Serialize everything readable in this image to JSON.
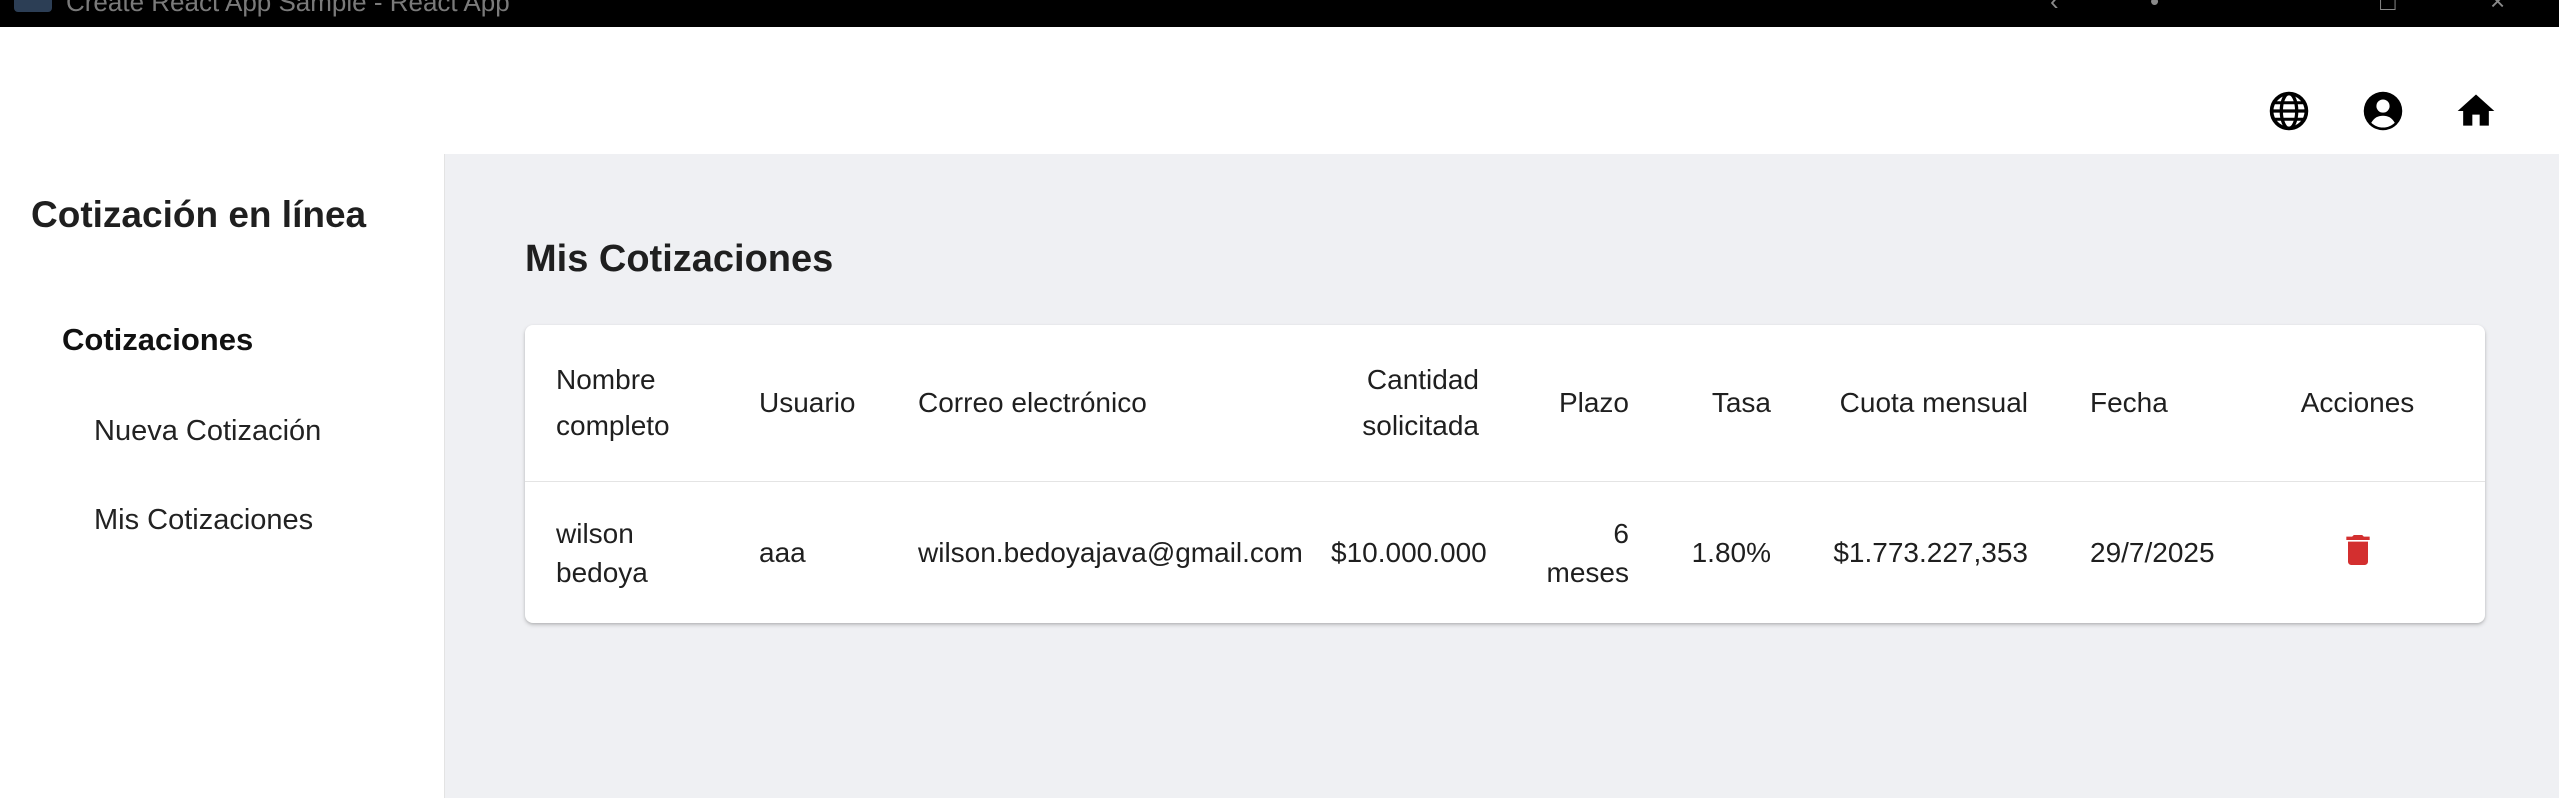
{
  "window": {
    "title": "Create React App Sample - React App"
  },
  "header": {
    "icons": [
      "globe-icon",
      "account-circle-icon",
      "home-icon"
    ]
  },
  "sidebar": {
    "app_title": "Cotización en línea",
    "section": "Cotizaciones",
    "items": [
      {
        "label": "Nueva Cotización"
      },
      {
        "label": "Mis Cotizaciones"
      }
    ]
  },
  "main": {
    "title": "Mis Cotizaciones",
    "table": {
      "headers": {
        "nombre": "Nombre completo",
        "usuario": "Usuario",
        "correo": "Correo electrónico",
        "cantidad": "Cantidad solicitada",
        "plazo": "Plazo",
        "tasa": "Tasa",
        "cuota": "Cuota mensual",
        "fecha": "Fecha",
        "acciones": "Acciones"
      },
      "rows": [
        {
          "nombre": "wilson bedoya",
          "usuario": "aaa",
          "correo": "wilson.bedoyajava@gmail.com",
          "cantidad": "$10.000.000",
          "plazo": "6 meses",
          "tasa": "1.80%",
          "cuota": "$1.773.227,353",
          "fecha": "29/7/2025",
          "action_icon": "delete-icon"
        }
      ]
    }
  },
  "colors": {
    "delete": "#d32f2f",
    "main_bg": "#eff0f3"
  }
}
